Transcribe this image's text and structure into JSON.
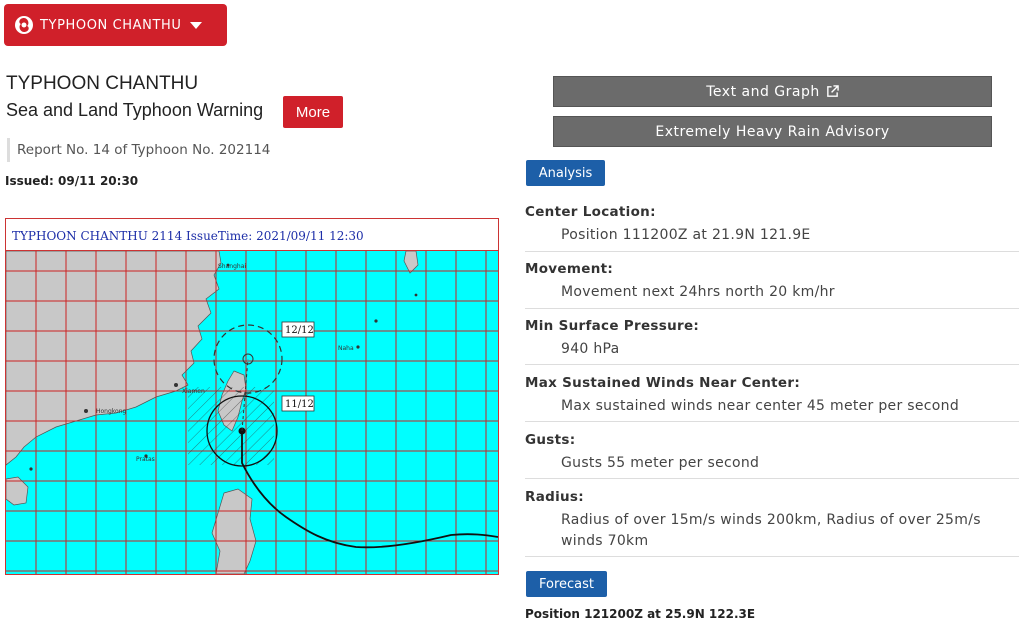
{
  "storm_select": {
    "label": "TYPHOON CHANTHU",
    "icon": "typhoon-icon"
  },
  "warning": {
    "title": "TYPHOON CHANTHU",
    "subtitle": "Sea and Land Typhoon Warning",
    "more_label": "More",
    "report": "Report No. 14 of Typhoon No. 202114",
    "issued": "Issued: 09/11 20:30"
  },
  "map": {
    "header": "TYPHOON CHANTHU 2114 IssueTime: 2021/09/11 12:30",
    "date_labels": [
      "12/12",
      "11/12"
    ],
    "place_labels": [
      "Shanghai",
      "Hongkong",
      "Xiamen",
      "Naha",
      "Pratas"
    ],
    "colors": {
      "sea": "#00ffff",
      "land": "#c8c8c8",
      "grid": "#cc2222"
    }
  },
  "actions": {
    "text_graph": "Text and Graph",
    "rain_advisory": "Extremely Heavy Rain Advisory"
  },
  "analysis": {
    "tag": "Analysis",
    "center_label": "Center Location:",
    "center_value": "Position 111200Z at 21.9N 121.9E",
    "movement_label": "Movement:",
    "movement_value": "Movement next 24hrs north 20 km/hr",
    "pressure_label": "Min Surface Pressure:",
    "pressure_value": "940 hPa",
    "winds_label": "Max Sustained Winds Near Center:",
    "winds_value": "Max sustained winds near center 45 meter per second",
    "gusts_label": "Gusts:",
    "gusts_value": "Gusts 55 meter per second",
    "radius_label": "Radius:",
    "radius_value": "Radius of over 15m/s winds 200km, Radius of over 25m/s winds 70km"
  },
  "forecast": {
    "tag": "Forecast",
    "position": "Position 121200Z at 25.9N 122.3E"
  },
  "colors": {
    "accent_red": "#d0202a",
    "tag_blue": "#1d5fa8",
    "button_gray": "#6b6b6b"
  }
}
